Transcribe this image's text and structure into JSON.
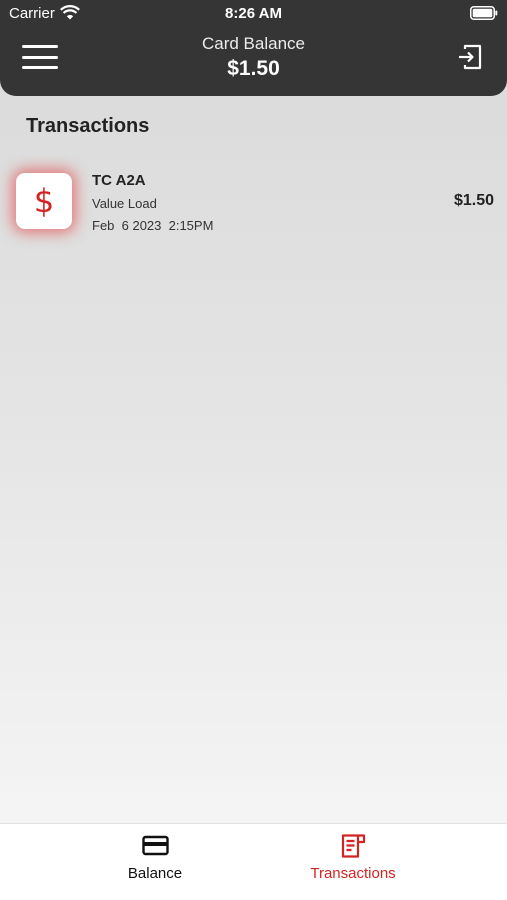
{
  "status_bar": {
    "carrier": "Carrier",
    "time": "8:26 AM"
  },
  "header": {
    "title": "Card Balance",
    "amount": "$1.50"
  },
  "section": {
    "title": "Transactions"
  },
  "transactions": [
    {
      "icon_glyph": "$",
      "name": "TC A2A",
      "type": "Value Load",
      "date": "Feb  6 2023  2:15PM",
      "amount": "$1.50"
    }
  ],
  "tabbar": {
    "tabs": [
      {
        "label": "Balance",
        "icon": "credit-card-icon",
        "active": false
      },
      {
        "label": "Transactions",
        "icon": "receipt-icon",
        "active": true
      }
    ]
  },
  "colors": {
    "accent": "#d42323",
    "header_bg": "#353535"
  }
}
